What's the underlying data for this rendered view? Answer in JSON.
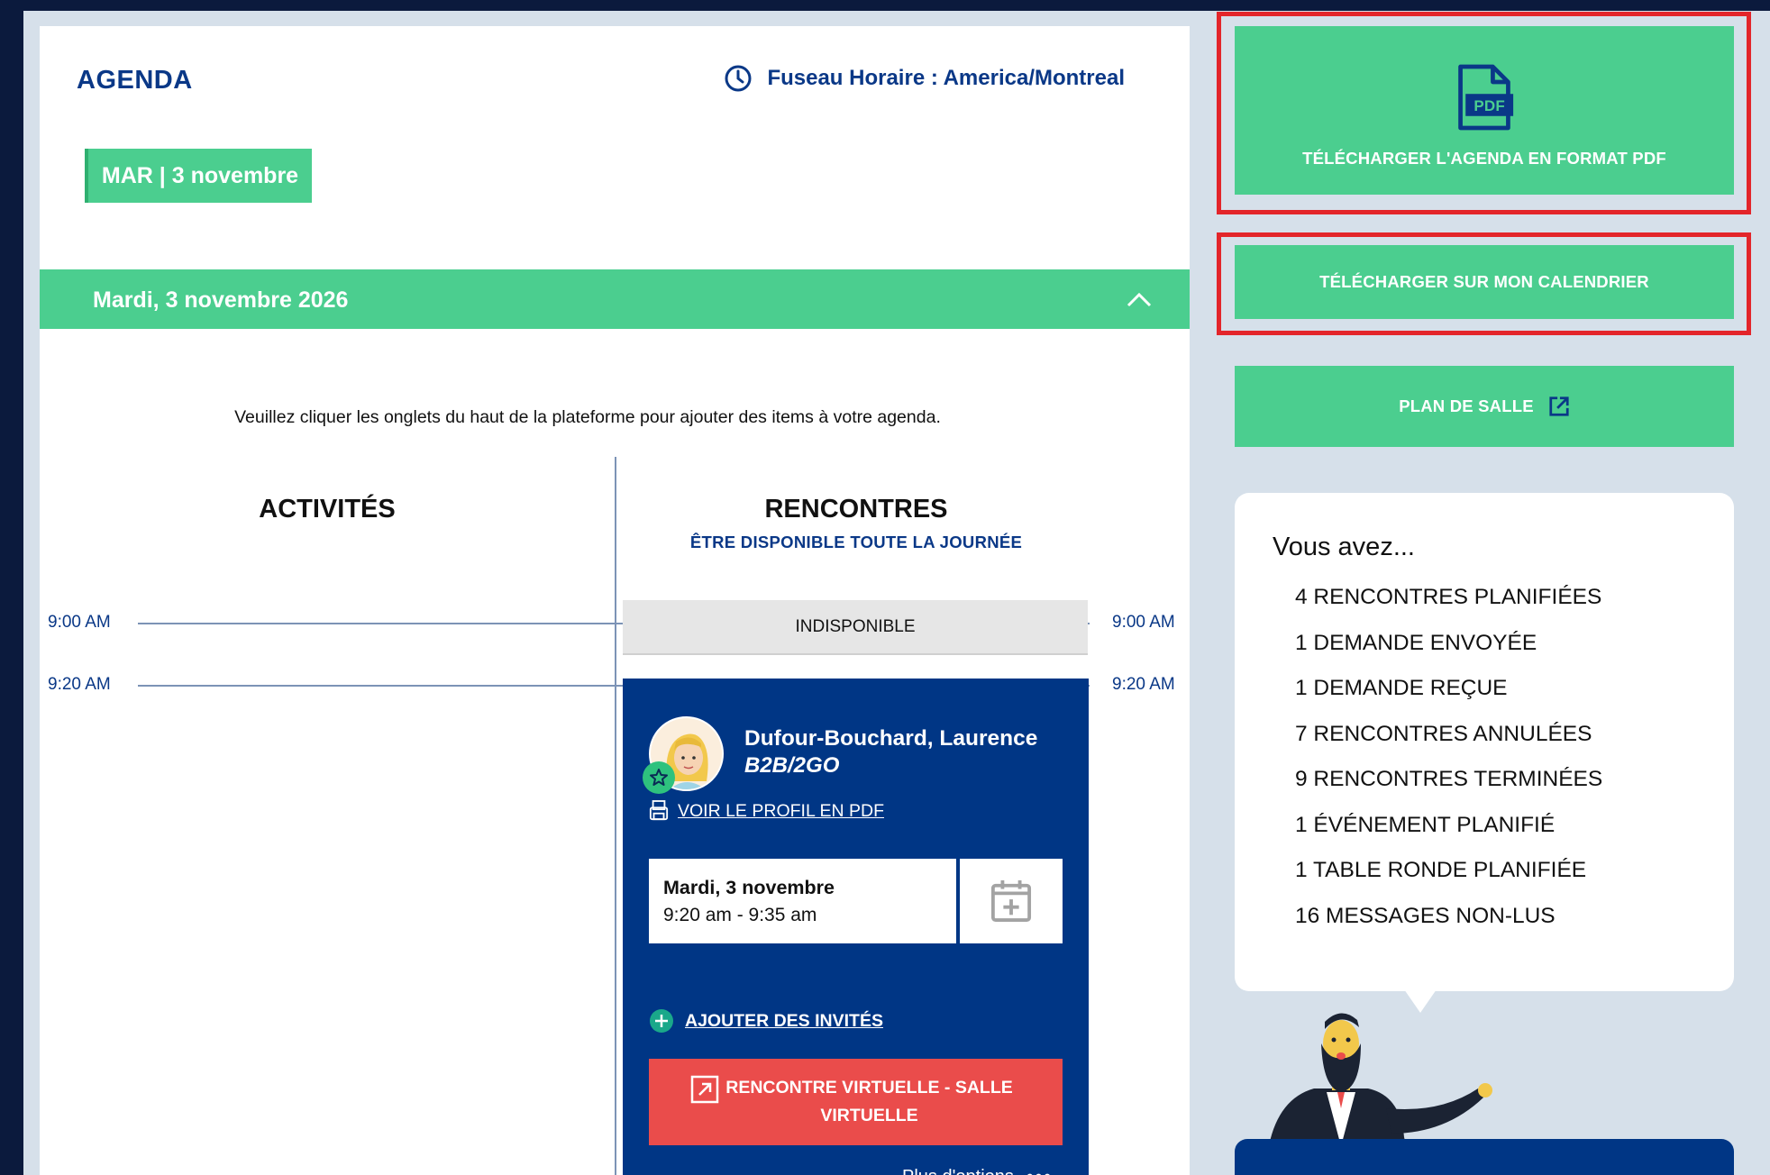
{
  "agenda": {
    "title": "AGENDA",
    "timezone_label": "Fuseau Horaire : America/Montreal",
    "date_tab": "MAR | 3 novembre",
    "day_header": "Mardi, 3 novembre 2026",
    "instruction": "Veuillez cliquer les onglets du haut de la plateforme pour ajouter des items à votre agenda.",
    "columns": {
      "activities": "ACTIVITÉS",
      "meetings": "RENCONTRES",
      "meetings_sub": "ÊTRE DISPONIBLE TOUTE LA JOURNÉE"
    },
    "times": [
      "9:00 AM",
      "9:20 AM"
    ],
    "unavailable": "INDISPONIBLE",
    "meeting_card": {
      "name": "Dufour-Bouchard, Laurence",
      "organization": "B2B/2GO",
      "profile_link": "VOIR LE PROFIL EN PDF",
      "date": "Mardi, 3 novembre",
      "time_range": "9:20 am - 9:35 am",
      "add_guests": "AJOUTER DES INVITÉS",
      "virtual_button": "RENCONTRE VIRTUELLE - SALLE VIRTUELLE",
      "more_options": "Plus d'options"
    }
  },
  "sidebar": {
    "pdf_icon_text": "PDF",
    "download_pdf": "TÉLÉCHARGER L'AGENDA EN FORMAT PDF",
    "download_calendar": "TÉLÉCHARGER SUR MON CALENDRIER",
    "floor_plan": "PLAN DE SALLE",
    "summary": {
      "heading": "Vous avez...",
      "items": [
        "4 RENCONTRES PLANIFIÉES",
        "1 DEMANDE ENVOYÉE",
        "1 DEMANDE REÇUE",
        "7 RENCONTRES ANNULÉES",
        "9 RENCONTRES TERMINÉES",
        "1 ÉVÉNEMENT PLANIFIÉ",
        "1 TABLE RONDE PLANIFIÉE",
        "16 MESSAGES NON-LUS"
      ]
    }
  },
  "colors": {
    "green": "#4bce8f",
    "navy": "#003685",
    "red": "#ea4c4b",
    "highlight": "#e3252a"
  }
}
